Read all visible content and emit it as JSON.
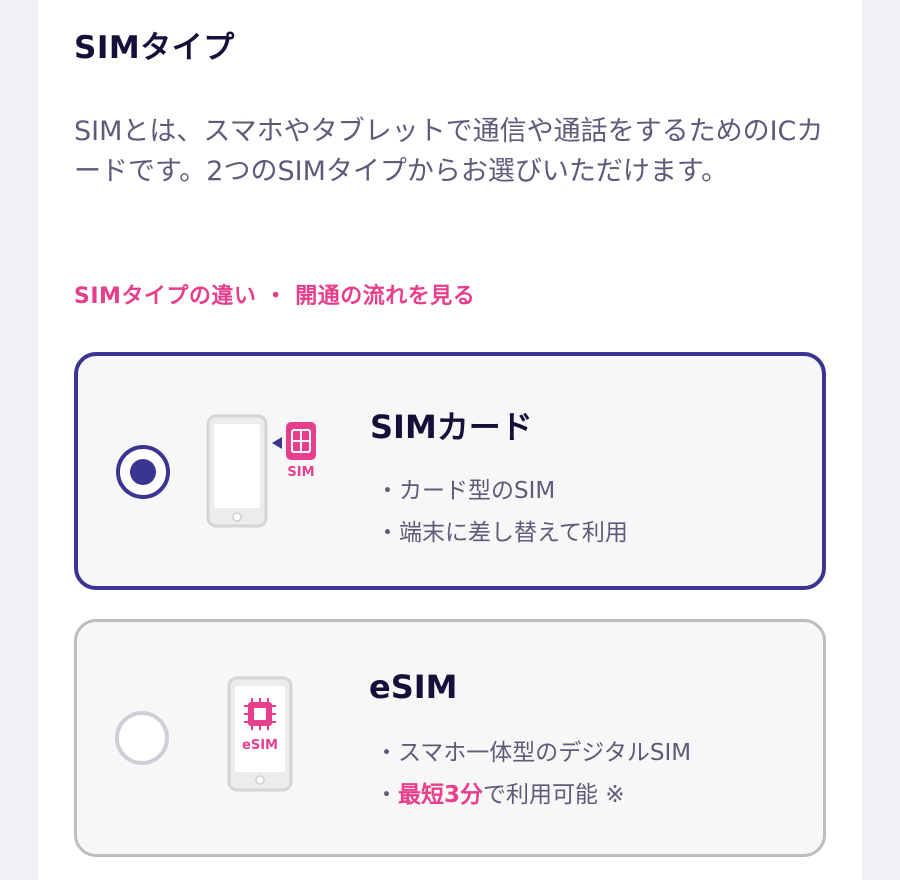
{
  "section": {
    "title": "SIMタイプ",
    "description": "SIMとは、スマホやタブレットで通信や通話をするためのICカードです。2つのSIMタイプからお選びいただけます。",
    "link_label": "SIMタイプの違い ・ 開通の流れを見る"
  },
  "options": [
    {
      "title": "SIMカード",
      "icon_name": "phone-with-sim-card-icon",
      "icon_label": "SIM",
      "selected": true,
      "features": [
        "・カード型のSIM",
        "・端末に差し替えて利用"
      ]
    },
    {
      "title": "eSIM",
      "icon_name": "phone-with-esim-chip-icon",
      "icon_label": "eSIM",
      "selected": false,
      "features": [
        "・スマホ一体型のデジタルSIM"
      ],
      "feature_highlight": {
        "prefix": "・",
        "highlight": "最短3分",
        "suffix": "で利用可能 ※"
      }
    }
  ],
  "colors": {
    "accent": "#3b3591",
    "pink": "#e83e8c",
    "text_dark": "#14103a",
    "text_muted": "#5f5a7a"
  }
}
